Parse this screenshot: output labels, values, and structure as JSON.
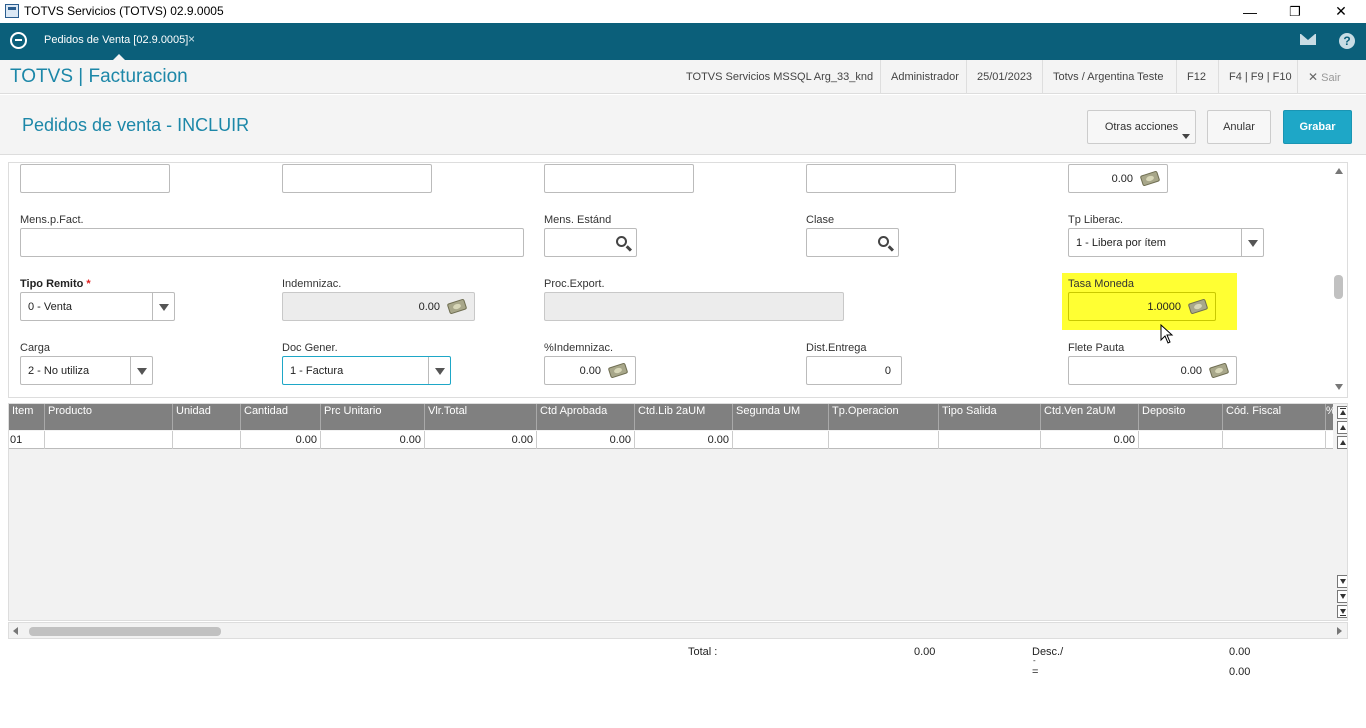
{
  "window": {
    "title": "TOTVS Servicios (TOTVS) 02.9.0005",
    "min": "—",
    "max": "❐",
    "close": "✕"
  },
  "tabbar": {
    "tab_label": "Pedidos de Venta [02.9.0005]",
    "tab_close": "×"
  },
  "header": {
    "brand": "TOTVS | Facturacion",
    "server": "TOTVS Servicios MSSQL Arg_33_knd",
    "user": "Administrador",
    "date": "25/01/2023",
    "company": "Totvs / Argentina Teste",
    "f12": "F12",
    "shortcuts": "F4 | F9 | F10",
    "exit": "Sair",
    "exit_icon": "✕"
  },
  "page": {
    "title": "Pedidos de venta - INCLUIR",
    "btn_more": "Otras acciones",
    "btn_cancel": "Anular",
    "btn_save": "Grabar"
  },
  "form": {
    "top_value": "0.00",
    "mens_fact_label": "Mens.p.Fact.",
    "mens_estand_label": "Mens. Estánd",
    "clase_label": "Clase",
    "tp_liberac_label": "Tp Liberac.",
    "tp_liberac_value": "1 - Libera por ítem",
    "tipo_remito_label": "Tipo Remito",
    "required_mark": "*",
    "tipo_remito_value": "0 - Venta",
    "indemnizac_label": "Indemnizac.",
    "indemnizac_value": "0.00",
    "proc_export_label": "Proc.Export.",
    "tasa_moneda_label": "Tasa Moneda",
    "tasa_moneda_value": "1.0000",
    "carga_label": "Carga",
    "carga_value": "2 - No utiliza",
    "doc_gener_label": "Doc Gener.",
    "doc_gener_value": "1 - Factura",
    "pct_indemnizac_label": "%Indemnizac.",
    "pct_indemnizac_value": "0.00",
    "dist_entrega_label": "Dist.Entrega",
    "dist_entrega_value": "0",
    "flete_pauta_label": "Flete Pauta",
    "flete_pauta_value": "0.00"
  },
  "grid": {
    "columns": [
      "Item",
      "Producto",
      "Unidad",
      "Cantidad",
      "Prc Unitario",
      "Vlr.Total",
      "Ctd Aprobada",
      "Ctd.Lib 2aUM",
      "Segunda UM",
      "Tp.Operacion",
      "Tipo Salida",
      "Ctd.Ven 2aUM",
      "Deposito",
      "Cód. Fiscal",
      "%"
    ],
    "row": [
      "01",
      "",
      "",
      "0.00",
      "0.00",
      "0.00",
      "0.00",
      "0.00",
      "",
      "",
      "",
      "0.00",
      "",
      ""
    ]
  },
  "totals": {
    "total_label": "Total :",
    "total_value": "0.00",
    "desc_label": "Desc./",
    "desc_sub": "-",
    "desc_value": "0.00",
    "eq_label": "=",
    "eq_value": "0.00"
  }
}
